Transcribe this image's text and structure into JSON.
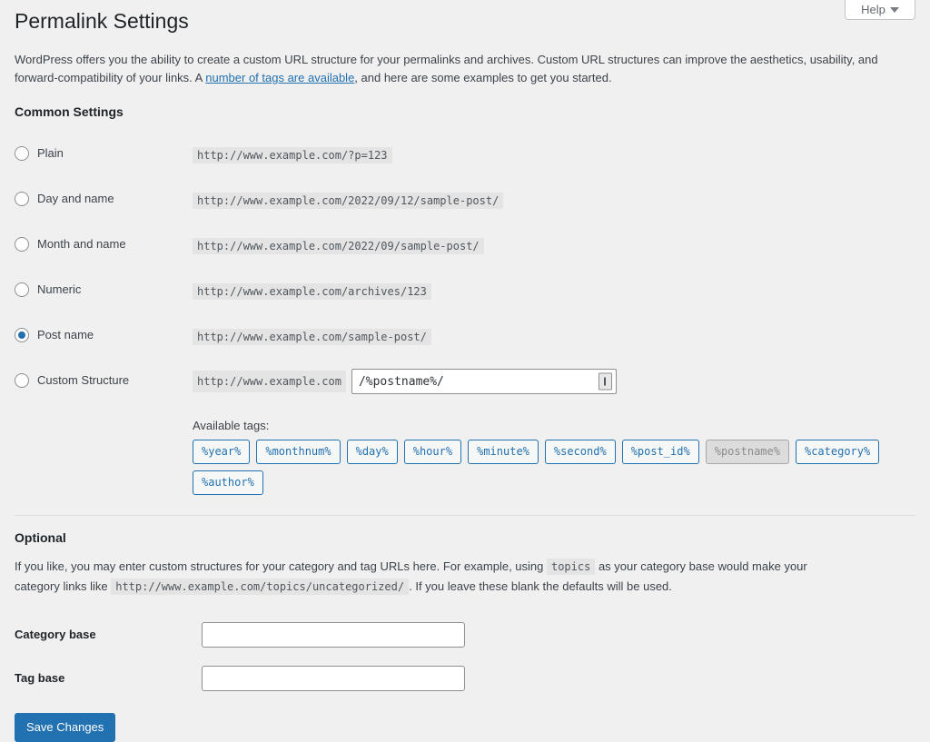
{
  "help_tab": {
    "label": "Help",
    "icon": "chevron-down-icon"
  },
  "page": {
    "title": "Permalink Settings",
    "intro_part1": "WordPress offers you the ability to create a custom URL structure for your permalinks and archives. Custom URL structures can improve the aesthetics, usability, and forward-compatibility of your links. A ",
    "intro_link": "number of tags are available",
    "intro_part2": ", and here are some examples to get you started."
  },
  "common_settings": {
    "heading": "Common Settings",
    "options": [
      {
        "label": "Plain",
        "example": "http://www.example.com/?p=123",
        "selected": false
      },
      {
        "label": "Day and name",
        "example": "http://www.example.com/2022/09/12/sample-post/",
        "selected": false
      },
      {
        "label": "Month and name",
        "example": "http://www.example.com/2022/09/sample-post/",
        "selected": false
      },
      {
        "label": "Numeric",
        "example": "http://www.example.com/archives/123",
        "selected": false
      },
      {
        "label": "Post name",
        "example": "http://www.example.com/sample-post/",
        "selected": true
      }
    ],
    "custom_structure": {
      "label": "Custom Structure",
      "prefix": "http://www.example.com",
      "value": "/%postname%/",
      "end_glyph": "resize-handle-icon"
    },
    "available_tags_label": "Available tags:",
    "tags": [
      {
        "label": "%year%",
        "disabled": false
      },
      {
        "label": "%monthnum%",
        "disabled": false
      },
      {
        "label": "%day%",
        "disabled": false
      },
      {
        "label": "%hour%",
        "disabled": false
      },
      {
        "label": "%minute%",
        "disabled": false
      },
      {
        "label": "%second%",
        "disabled": false
      },
      {
        "label": "%post_id%",
        "disabled": false
      },
      {
        "label": "%postname%",
        "disabled": true
      },
      {
        "label": "%category%",
        "disabled": false
      },
      {
        "label": "%author%",
        "disabled": false
      }
    ]
  },
  "optional": {
    "heading": "Optional",
    "desc_part1": "If you like, you may enter custom structures for your category and tag URLs here. For example, using ",
    "desc_code1": "topics",
    "desc_part2": " as your category base would make your category links like ",
    "desc_code2": "http://www.example.com/topics/uncategorized/",
    "desc_part3": ". If you leave these blank the defaults will be used.",
    "fields": [
      {
        "label": "Category base",
        "value": "",
        "placeholder": ""
      },
      {
        "label": "Tag base",
        "value": "",
        "placeholder": ""
      }
    ]
  },
  "actions": {
    "save_label": "Save Changes"
  },
  "colors": {
    "accent": "#2271b1",
    "page_bg": "#f0f0f1",
    "text": "#3c434a",
    "code_bg": "#e4e4e4"
  }
}
